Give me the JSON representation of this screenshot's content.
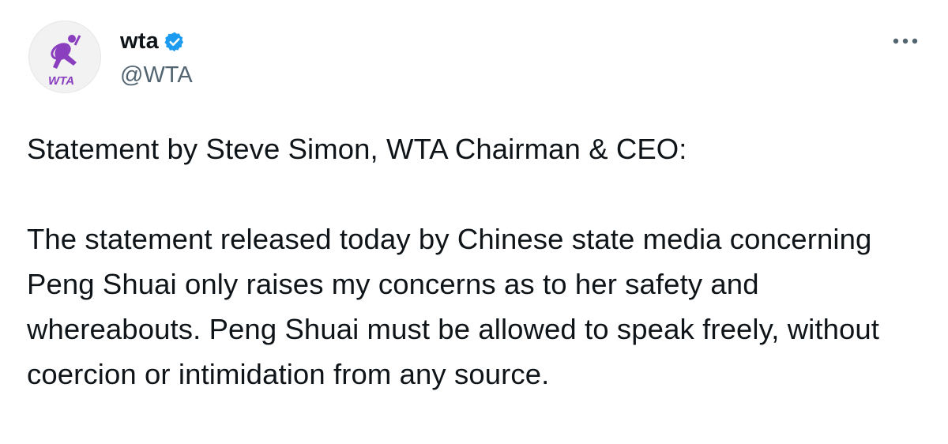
{
  "author": {
    "display_name": "wta",
    "handle": "@WTA",
    "verified": true,
    "avatar": {
      "icon": "wta-logo-icon",
      "logo_text": "WTA",
      "logo_color": "#8a3fbf"
    }
  },
  "actions": {
    "more_icon": "more-horizontal-icon"
  },
  "tweet": {
    "paragraphs": [
      "Statement by Steve Simon, WTA Chairman & CEO:",
      "The statement released today by Chinese state media concerning Peng Shuai only raises my concerns as to her safety and whereabouts. Peng Shuai must be allowed to speak freely, without coercion or intimidation from any source."
    ]
  },
  "colors": {
    "text_primary": "#0f1419",
    "text_secondary": "#536471",
    "verified_blue": "#1d9bf0",
    "brand_purple": "#8a3fbf"
  }
}
